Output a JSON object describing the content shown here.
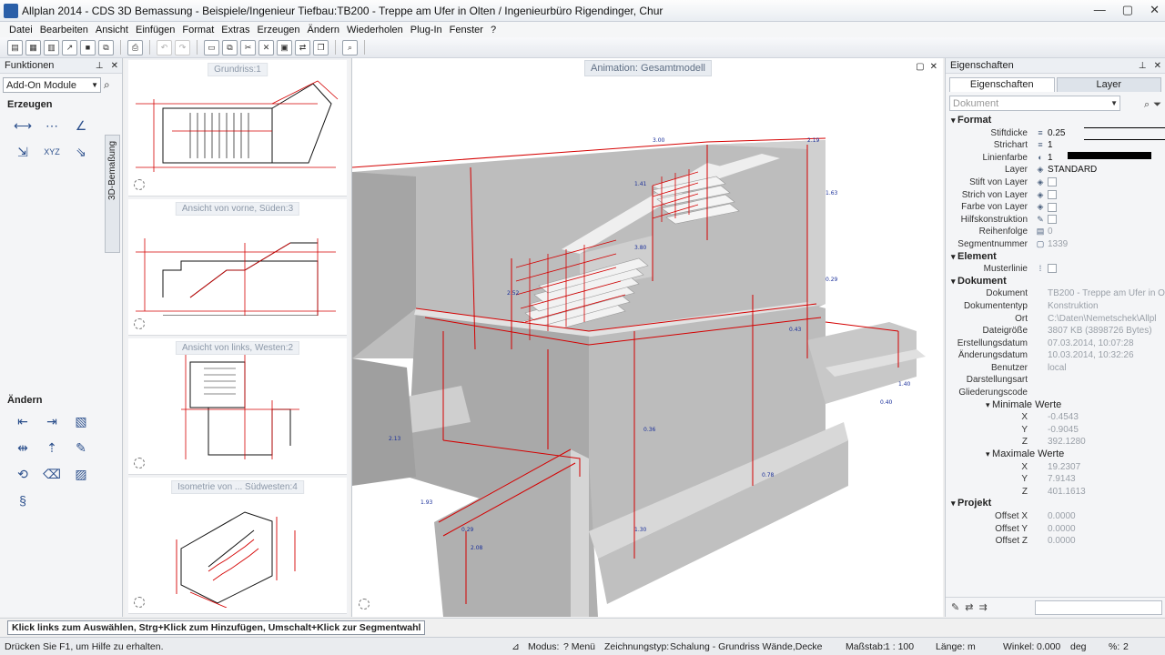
{
  "window": {
    "title": "Allplan 2014 - CDS 3D Bemassung - Beispiele/Ingenieur Tiefbau:TB200 - Treppe am Ufer in Olten / Ingenieurbüro Rigendinger, Chur",
    "controls": [
      "—",
      "▢",
      "✕"
    ]
  },
  "menu": [
    "Datei",
    "Bearbeiten",
    "Ansicht",
    "Einfügen",
    "Format",
    "Extras",
    "Erzeugen",
    "Ändern",
    "Wiederholen",
    "Plug-In",
    "Fenster",
    "?"
  ],
  "left_panel": {
    "title": "Funktionen",
    "module_dropdown": "Add-On Module",
    "section_create": "Erzeugen",
    "section_modify": "Ändern",
    "vertical_tab": "3D-Bemaßung"
  },
  "thumbnails": [
    {
      "label": "Grundriss:1"
    },
    {
      "label": "Ansicht von vorne, Süden:3"
    },
    {
      "label": "Ansicht von links, Westen:2"
    },
    {
      "label": "Isometrie von ... Südwesten:4"
    }
  ],
  "viewport": {
    "label": "Animation: Gesamtmodell"
  },
  "right_panel": {
    "title": "Eigenschaften",
    "tabs": [
      "Eigenschaften",
      "Layer"
    ],
    "doc_dropdown": "Dokument",
    "groups": {
      "format": "Format",
      "element": "Element",
      "dokument": "Dokument",
      "min": "Minimale Werte",
      "max": "Maximale Werte",
      "projekt": "Projekt"
    },
    "format_rows": [
      {
        "key": "Stiftdicke",
        "value": "0.25"
      },
      {
        "key": "Strichart",
        "value": "1"
      },
      {
        "key": "Linienfarbe",
        "value": "1"
      },
      {
        "key": "Layer",
        "value": "STANDARD"
      },
      {
        "key": "Stift von Layer",
        "value": ""
      },
      {
        "key": "Strich von Layer",
        "value": ""
      },
      {
        "key": "Farbe von Layer",
        "value": ""
      },
      {
        "key": "Hilfskonstruktion",
        "value": ""
      },
      {
        "key": "Reihenfolge",
        "value": "0"
      },
      {
        "key": "Segmentnummer",
        "value": "1339"
      }
    ],
    "element_rows": [
      {
        "key": "Musterlinie",
        "value": ""
      }
    ],
    "dokument_rows": [
      {
        "key": "Dokument",
        "value": "TB200 - Treppe am Ufer in O"
      },
      {
        "key": "Dokumententyp",
        "value": "Konstruktion"
      },
      {
        "key": "Ort",
        "value": "C:\\Daten\\Nemetschek\\Allpl"
      },
      {
        "key": "Dateigröße",
        "value": "3807 KB (3898726 Bytes)"
      },
      {
        "key": "Erstellungsdatum",
        "value": "07.03.2014, 10:07:28"
      },
      {
        "key": "Änderungsdatum",
        "value": "10.03.2014, 10:32:26"
      },
      {
        "key": "Benutzer",
        "value": "local"
      },
      {
        "key": "Darstellungsart",
        "value": ""
      },
      {
        "key": "Gliederungscode",
        "value": ""
      }
    ],
    "min_rows": [
      {
        "key": "X",
        "value": "-0.4543"
      },
      {
        "key": "Y",
        "value": "-0.9045"
      },
      {
        "key": "Z",
        "value": "392.1280"
      }
    ],
    "max_rows": [
      {
        "key": "X",
        "value": "19.2307"
      },
      {
        "key": "Y",
        "value": "7.9143"
      },
      {
        "key": "Z",
        "value": "401.1613"
      }
    ],
    "projekt_rows": [
      {
        "key": "Offset X",
        "value": "0.0000"
      },
      {
        "key": "Offset Y",
        "value": "0.0000"
      },
      {
        "key": "Offset Z",
        "value": "0.0000"
      }
    ]
  },
  "prompt": "Klick links zum Auswählen, Strg+Klick zum Hinzufügen, Umschalt+Klick zur Segmentwahl",
  "status": {
    "help": "Drücken Sie F1, um Hilfe zu erhalten.",
    "modus_label": "Modus:",
    "modus_value": "? Menü",
    "zt_label": "Zeichnungstyp:",
    "zt_value": "Schalung  -  Grundriss Wände,Decke",
    "massstab_label": "Maßstab:",
    "massstab_value": "1 : 100",
    "laenge_label": "Länge:",
    "laenge_value": "m",
    "winkel_label": "Winkel:",
    "winkel_value": "0.000",
    "winkel_unit": "deg",
    "pct_label": "%:",
    "pct_value": "2"
  },
  "colors": {
    "accent_red": "#d40000",
    "concrete": "#b8b8b8",
    "dim_blue": "#1a2f9a"
  }
}
